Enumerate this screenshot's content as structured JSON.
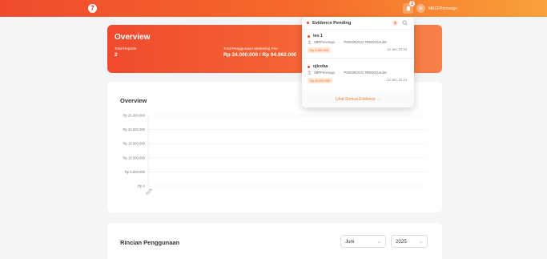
{
  "topbar": {
    "logo_letter": "7",
    "notif_count": "2",
    "user_initial": "M",
    "user_name": "MKCFPonorogo"
  },
  "overview_banner": {
    "title": "Overview",
    "stats": [
      {
        "label": "Total Reports",
        "value": "2"
      },
      {
        "label": "Total Penggunaan Marketing Fee",
        "value": "Rp 24.000.000 / Rp 94.962.000"
      }
    ]
  },
  "chart_card": {
    "title": "Overview"
  },
  "chart_data": {
    "type": "bar",
    "title": "Overview",
    "categories": [
      "2025"
    ],
    "values": [
      0
    ],
    "y_ticks": [
      "Rp 0",
      "Rp 5.000.000",
      "Rp 10.000.000",
      "Rp 15.000.000",
      "Rp 20.000.000",
      "Rp 25.000.000"
    ],
    "ylim": [
      0,
      25000000
    ],
    "grid": true
  },
  "rincian": {
    "title": "Rincian Penggunaan",
    "month": "Juni",
    "year": "2025"
  },
  "notifications": {
    "title": "Evidence Pending",
    "count": "2",
    "items": [
      {
        "title": "tes 1",
        "branch": "SBPPonorogo",
        "area": "PONOROGO,TRENGGALEK",
        "amount": "Rp 4.000.000",
        "date": "12 Jun, 23:16"
      },
      {
        "title": "ujicoba",
        "branch": "SBPPonorogo",
        "area": "PONOROGO,TRENGGALEK",
        "amount": "Rp 20.000.000",
        "date": "12 Jun, 22:14"
      }
    ],
    "footer": "Lihat Semua Evidence →"
  },
  "colors": {
    "accent": "#f04a2e",
    "accent2": "#f9a13a"
  }
}
